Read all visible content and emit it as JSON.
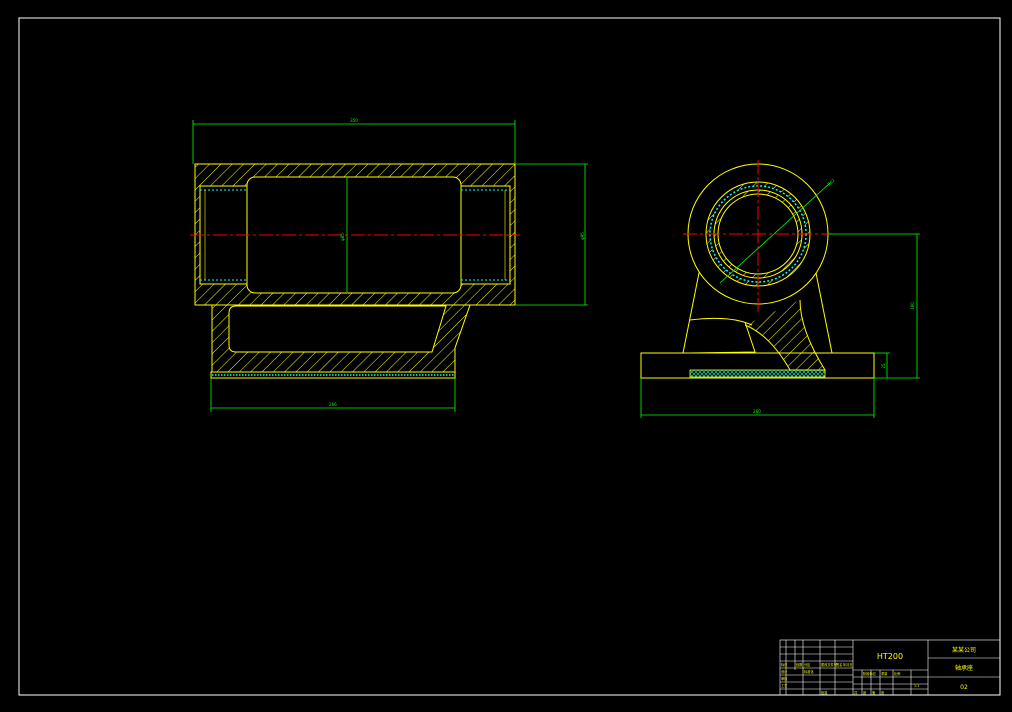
{
  "drawing": {
    "dimensions": {
      "front_width": "350",
      "front_bore": "φ85",
      "front_height": "φ95",
      "front_base_width": "266",
      "side_radius": "R62",
      "side_center_height": "160",
      "side_base_height": "25",
      "side_base_width": "260"
    },
    "title_block": {
      "material": "HT200",
      "company": "某某公司",
      "part_name": "轴承座",
      "drawing_no": "02",
      "cells": [
        "标记",
        "处数",
        "分区",
        "更改文件号",
        "签名",
        "年月日",
        "设计",
        "标准化",
        "审核",
        "工艺",
        "批准",
        "阶段标记",
        "重量",
        "比例",
        "共",
        "张",
        "第",
        "张",
        "1:1"
      ]
    }
  },
  "colors": {
    "background": "#000000",
    "border": "#ffffff",
    "outline": "#ffff00",
    "dimension": "#00ff00",
    "centerline": "#ff0000",
    "hidden": "#00ffff"
  }
}
